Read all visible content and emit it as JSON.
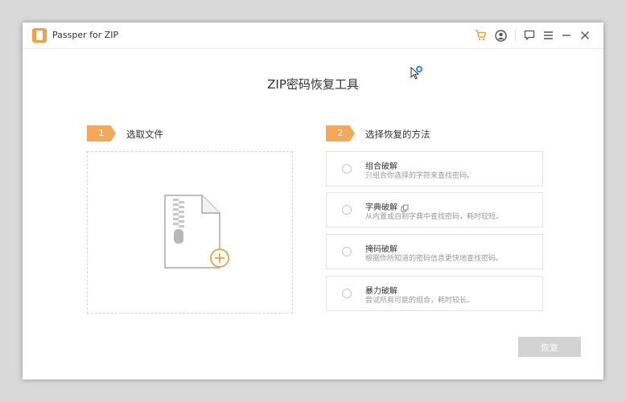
{
  "app": {
    "title": "Passper for ZIP"
  },
  "main": {
    "title": "ZIP密码恢复工具"
  },
  "steps": [
    {
      "number": "1",
      "label": "选取文件"
    },
    {
      "number": "2",
      "label": "选择恢复的方法"
    }
  ],
  "options": [
    {
      "title": "组合破解",
      "desc": "只组合你选择的字符来查找密码。"
    },
    {
      "title": "字典破解",
      "desc": "从内置或自制字典中查找密码，耗时较短。"
    },
    {
      "title": "掩码破解",
      "desc": "根据你所知道的密码信息更快地查找密码。"
    },
    {
      "title": "暴力破解",
      "desc": "尝试所有可能的组合，耗时较长。"
    }
  ],
  "actions": {
    "recover_label": "恢复"
  },
  "colors": {
    "accent": "#f3a85a",
    "disabled_button": "#d3d3d3",
    "cursor_badge": "#1e90ff"
  }
}
